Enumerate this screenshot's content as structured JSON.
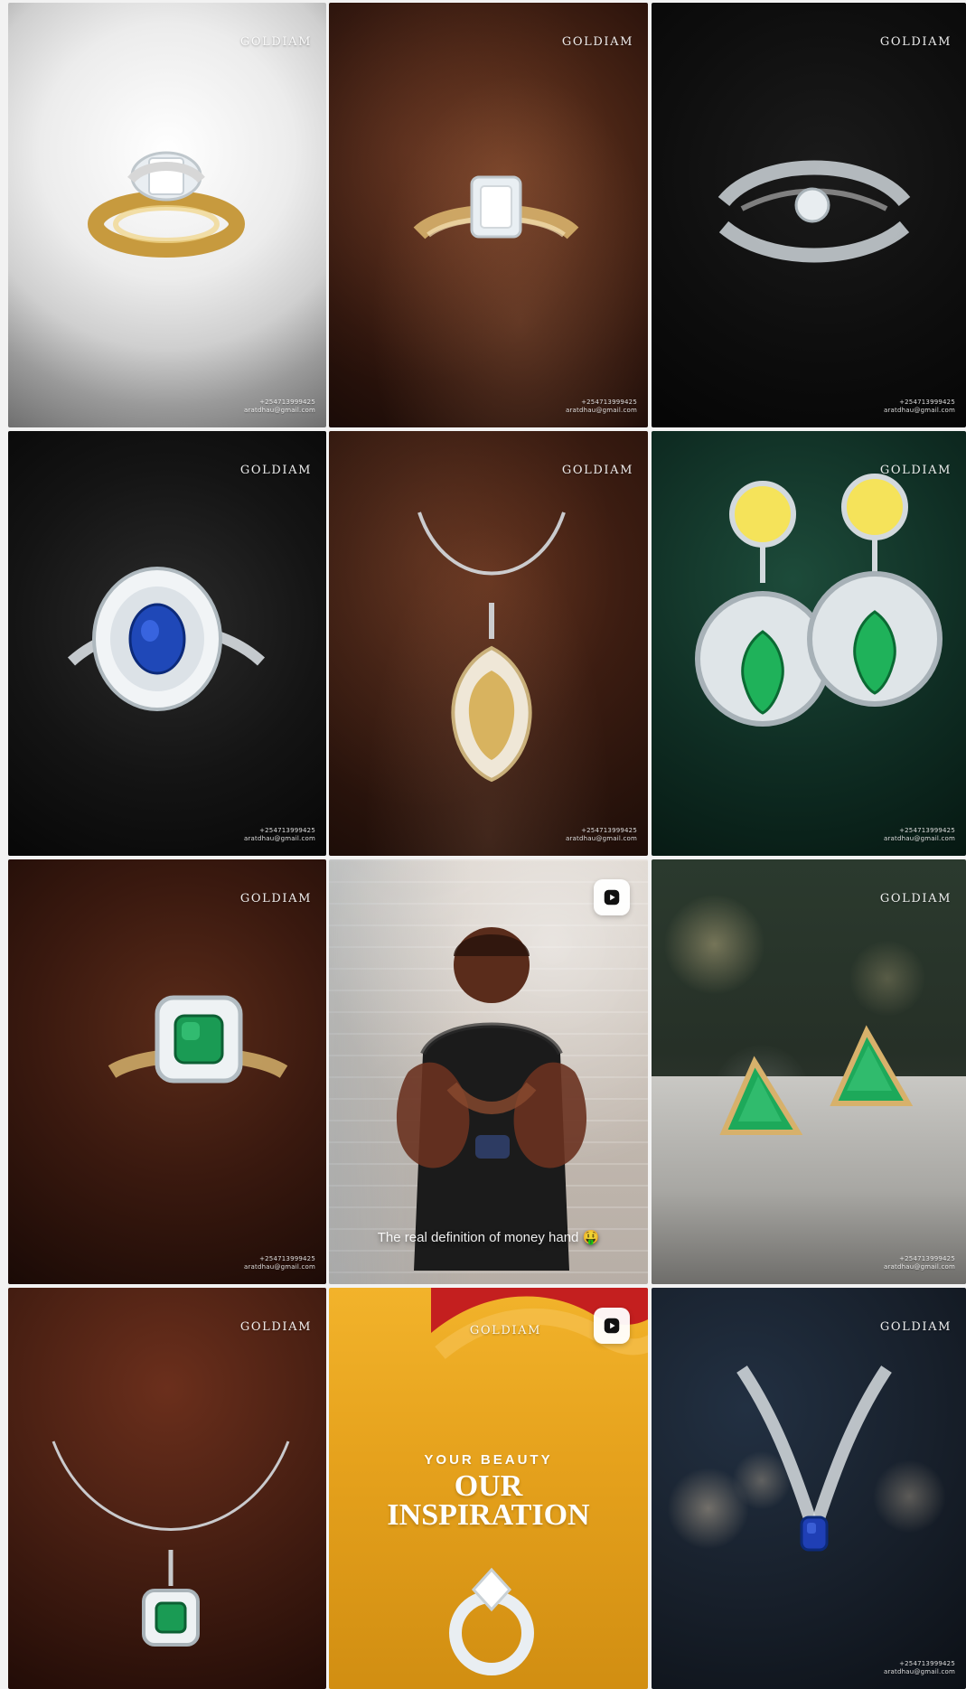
{
  "grid": {
    "tiles": [
      {
        "id": "tile-1",
        "brand": "GOLDIAM",
        "contact": {
          "phone": "+254713999425",
          "email": "aratdhau@gmail.com"
        }
      },
      {
        "id": "tile-2",
        "brand": "GOLDIAM",
        "contact": {
          "phone": "+254713999425",
          "email": "aratdhau@gmail.com"
        }
      },
      {
        "id": "tile-3",
        "brand": "GOLDIAM",
        "contact": {
          "phone": "+254713999425",
          "email": "aratdhau@gmail.com"
        }
      },
      {
        "id": "tile-4",
        "brand": "GOLDIAM",
        "contact": {
          "phone": "+254713999425",
          "email": "aratdhau@gmail.com"
        }
      },
      {
        "id": "tile-5",
        "brand": "GOLDIAM",
        "contact": {
          "phone": "+254713999425",
          "email": "aratdhau@gmail.com"
        }
      },
      {
        "id": "tile-6",
        "brand": "GOLDIAM",
        "contact": {
          "phone": "+254713999425",
          "email": "aratdhau@gmail.com"
        }
      },
      {
        "id": "tile-7",
        "brand": "GOLDIAM",
        "contact": {
          "phone": "+254713999425",
          "email": "aratdhau@gmail.com"
        }
      },
      {
        "id": "tile-8",
        "reel": true,
        "caption": "The real definition of money hand 🤑"
      },
      {
        "id": "tile-9",
        "brand": "GOLDIAM",
        "contact": {
          "phone": "+254713999425",
          "email": "aratdhau@gmail.com"
        }
      },
      {
        "id": "tile-10",
        "brand": "GOLDIAM"
      },
      {
        "id": "tile-11",
        "reel": true,
        "brand": "GOLDIAM",
        "promo": {
          "small": "YOUR BEAUTY",
          "big_line_1": "OUR",
          "big_line_2": "INSPIRATION"
        }
      },
      {
        "id": "tile-12",
        "brand": "GOLDIAM",
        "contact": {
          "phone": "+254713999425",
          "email": "aratdhau@gmail.com"
        }
      }
    ]
  },
  "icons": {
    "reel": "reel-icon"
  }
}
